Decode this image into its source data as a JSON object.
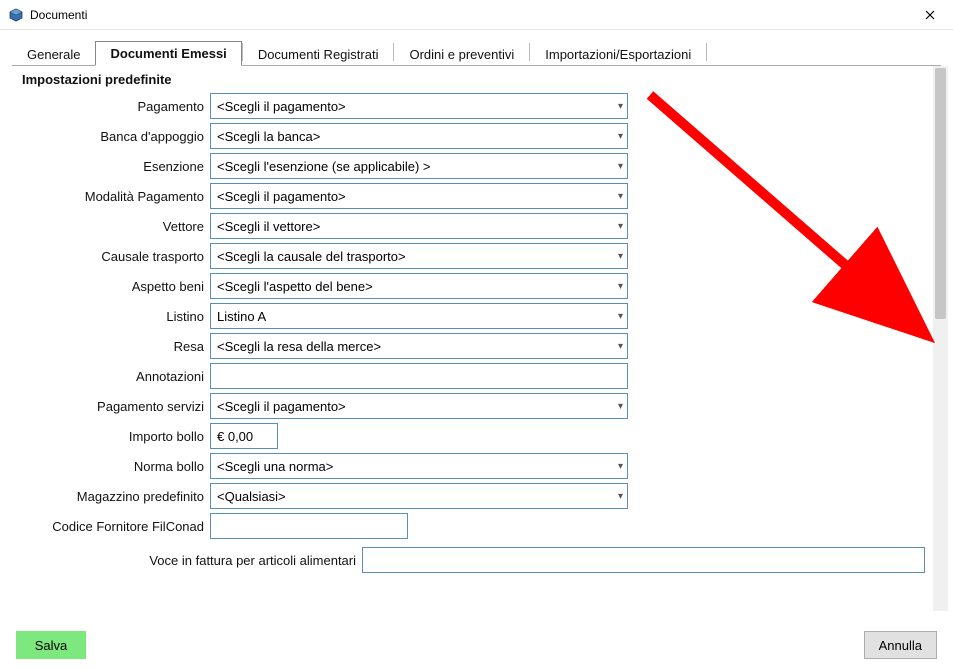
{
  "window": {
    "title": "Documenti"
  },
  "tabs": {
    "generale": "Generale",
    "documenti_emessi": "Documenti Emessi",
    "documenti_registrati": "Documenti Registrati",
    "ordini_preventivi": "Ordini e preventivi",
    "import_export": "Importazioni/Esportazioni"
  },
  "section": {
    "legend": "Impostazioni predefinite"
  },
  "labels": {
    "pagamento": "Pagamento",
    "banca": "Banca d'appoggio",
    "esenzione": "Esenzione",
    "modalita_pagamento": "Modalità Pagamento",
    "vettore": "Vettore",
    "causale_trasporto": "Causale trasporto",
    "aspetto_beni": "Aspetto beni",
    "listino": "Listino",
    "resa": "Resa",
    "annotazioni": "Annotazioni",
    "pagamento_servizi": "Pagamento servizi",
    "importo_bollo": "Importo bollo",
    "norma_bollo": "Norma bollo",
    "magazzino": "Magazzino predefinito",
    "codice_fornitore": "Codice Fornitore FilConad",
    "voce_fattura": "Voce in fattura per articoli alimentari"
  },
  "values": {
    "pagamento": "<Scegli il pagamento>",
    "banca": "<Scegli la banca>",
    "esenzione": "<Scegli l'esenzione (se applicabile) >",
    "modalita_pagamento": "<Scegli il pagamento>",
    "vettore": "<Scegli il vettore>",
    "causale_trasporto": "<Scegli la causale del trasporto>",
    "aspetto_beni": "<Scegli l'aspetto del bene>",
    "listino": "Listino A",
    "resa": "<Scegli la resa della merce>",
    "annotazioni": "",
    "pagamento_servizi": "<Scegli il pagamento>",
    "importo_bollo": "€ 0,00",
    "norma_bollo": "<Scegli una norma>",
    "magazzino": "<Qualsiasi>",
    "codice_fornitore": "",
    "voce_fattura": ""
  },
  "buttons": {
    "save": "Salva",
    "cancel": "Annulla"
  }
}
